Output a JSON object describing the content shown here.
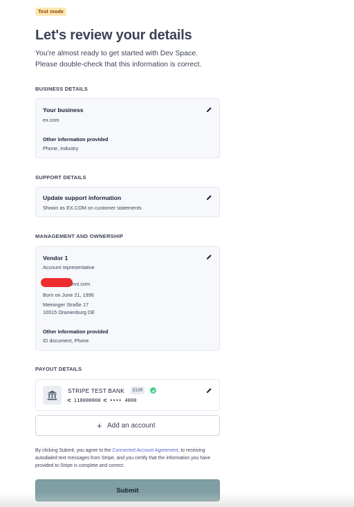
{
  "badge": "Test mode",
  "title": "Let's review your details",
  "subtitle": "You're almost ready to get started with Dev Space. Please double-check that this information is correct.",
  "business": {
    "heading": "BUSINESS DETAILS",
    "card_title": "Your business",
    "website": "ex.com",
    "other_label": "Other information provided",
    "other_value": "Phone, Industry"
  },
  "support": {
    "heading": "SUPPORT DETAILS",
    "card_title": "Update support information",
    "statement": "Shown as EX.COM on customer statements"
  },
  "management": {
    "heading": "MANAGEMENT AND OWNERSHIP",
    "name": "Vendor 1",
    "role": "Account representative",
    "email_visible": "evs.com",
    "born": "Born on June 21, 1996",
    "address_line1": "Meininger Straße 17",
    "address_line2": "16515 Oranienburg DE",
    "other_label": "Other information provided",
    "other_value": "ID document, Phone"
  },
  "payout": {
    "heading": "PAYOUT DETAILS",
    "bank_name": "STRIPE TEST BANK",
    "currency": "EUR",
    "account_line": "⑆ 110000000 ⑆ •••• 4000",
    "add_account_label": "Add an account"
  },
  "legal": {
    "prefix": "By clicking Submit, you agree to the ",
    "link": "Connected Account Agreement",
    "suffix": ", to receiving autodialed text messages from Stripe, and you certify that the information you have provided to Stripe is complete and correct."
  },
  "submit_label": "Submit",
  "colors": {
    "accent_link": "#5469d4",
    "submit_bg": "#7f9fa3",
    "badge_bg": "#fde8b4",
    "verified": "#3ecf8e",
    "redaction": "#ee2e2e"
  }
}
